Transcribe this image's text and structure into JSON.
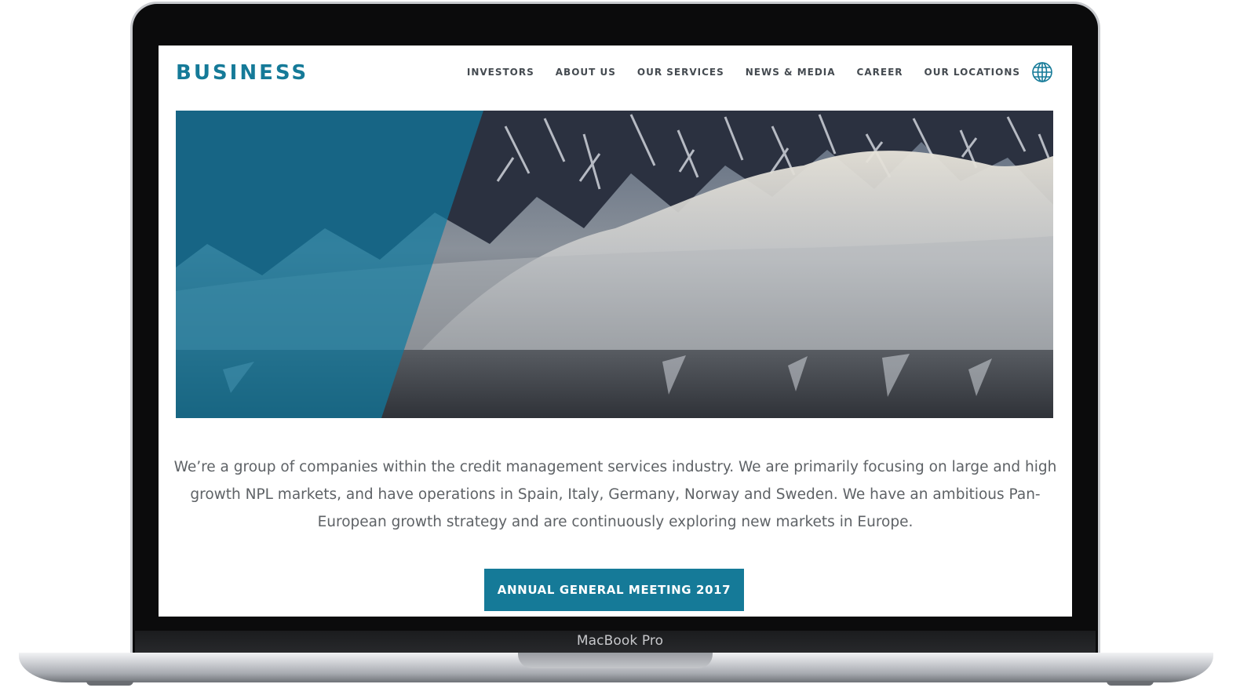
{
  "device": {
    "model_label": "MacBook Pro"
  },
  "site": {
    "logo": "BUSINESS",
    "nav": [
      {
        "label": "INVESTORS"
      },
      {
        "label": "ABOUT US"
      },
      {
        "label": "OUR SERVICES"
      },
      {
        "label": "NEWS & MEDIA"
      },
      {
        "label": "CAREER"
      },
      {
        "label": "OUR LOCATIONS"
      }
    ],
    "language_icon": "globe-icon",
    "intro": "We’re a group of companies within the credit management services industry. We are primarily focusing on large and high growth NPL markets, and have operations in Spain, Italy, Germany, Norway and Sweden. We have an ambitious Pan-European growth strategy and are continuously exploring new markets in Europe.",
    "cta": "ANNUAL GENERAL MEETING 2017"
  },
  "colors": {
    "brand": "#157a98",
    "nav_text": "#444a50",
    "body_text": "#5e6266",
    "hero_overlay": "#0f7aa0"
  }
}
